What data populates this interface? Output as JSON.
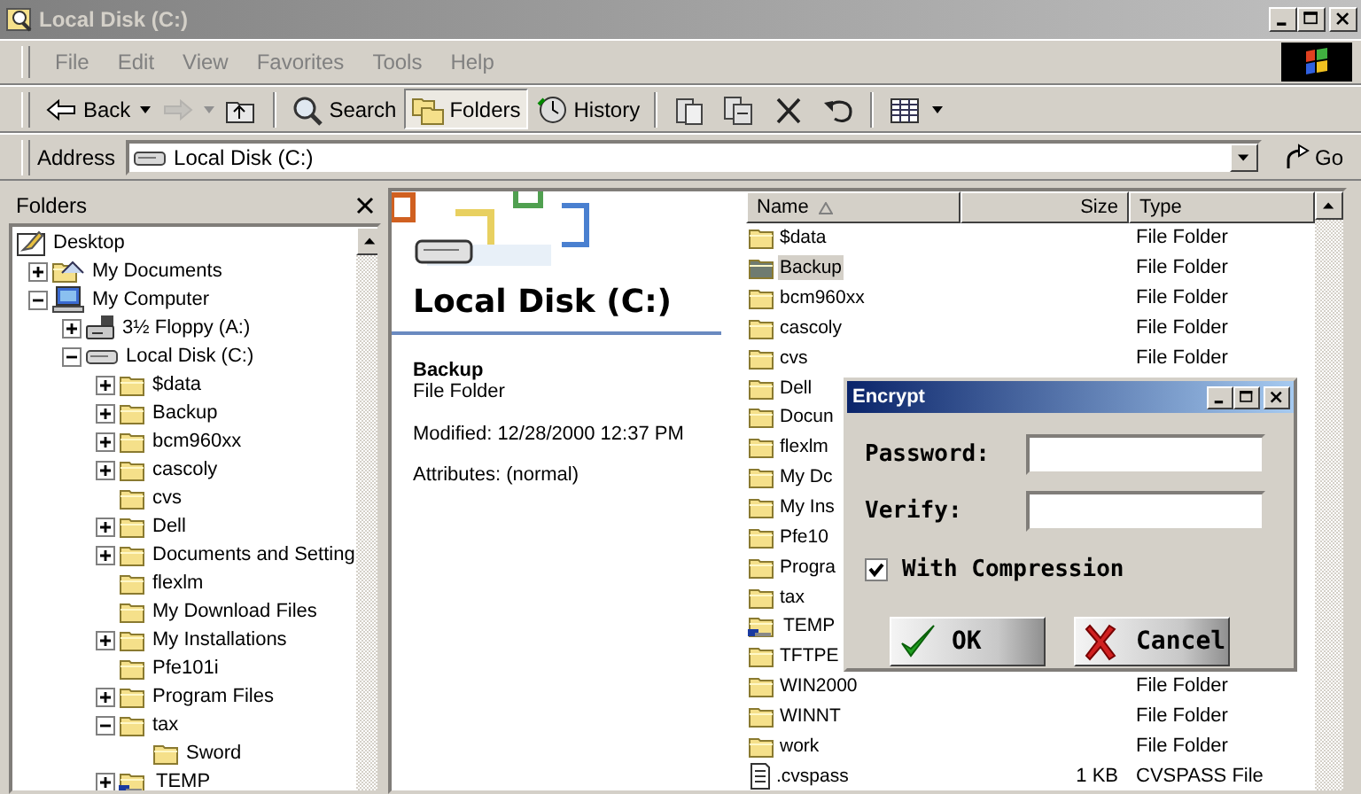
{
  "window": {
    "title": "Local Disk (C:)",
    "active": false
  },
  "menu": [
    "File",
    "Edit",
    "View",
    "Favorites",
    "Tools",
    "Help"
  ],
  "toolbar": {
    "groups": [
      [
        {
          "kind": "back",
          "label": "Back",
          "selected": false,
          "disabled": false
        },
        {
          "kind": "forward",
          "selected": false,
          "disabled": true
        },
        {
          "kind": "up",
          "selected": false,
          "disabled": false
        }
      ],
      [
        {
          "kind": "search",
          "label": "Search",
          "selected": false,
          "disabled": false
        },
        {
          "kind": "folders",
          "label": "Folders",
          "selected": true,
          "disabled": false
        },
        {
          "kind": "history",
          "label": "History",
          "selected": false,
          "disabled": false
        }
      ],
      [
        {
          "kind": "move",
          "selected": false,
          "disabled": false
        },
        {
          "kind": "copy",
          "selected": false,
          "disabled": false
        },
        {
          "kind": "delete",
          "selected": false,
          "disabled": false
        },
        {
          "kind": "undo",
          "selected": false,
          "disabled": false
        }
      ],
      [
        {
          "kind": "views",
          "selected": false,
          "disabled": false
        }
      ]
    ]
  },
  "address": {
    "label": "Address",
    "value": "Local Disk (C:)",
    "go": "Go"
  },
  "folders": {
    "title": "Folders",
    "tree": [
      {
        "kind": "desktop",
        "label": "Desktop",
        "expandable": false,
        "children": [
          {
            "kind": "documents",
            "label": "My Documents",
            "expandable": true,
            "expanded": false
          },
          {
            "kind": "computer",
            "label": "My Computer",
            "expandable": true,
            "expanded": true,
            "children": [
              {
                "kind": "floppy",
                "label": "3½ Floppy (A:)",
                "expandable": true,
                "expanded": false
              },
              {
                "kind": "drive",
                "label": "Local Disk (C:)",
                "expandable": true,
                "expanded": true,
                "children": [
                  {
                    "kind": "folder",
                    "label": "$data",
                    "expandable": true,
                    "expanded": false
                  },
                  {
                    "kind": "folder",
                    "label": "Backup",
                    "expandable": true,
                    "expanded": false
                  },
                  {
                    "kind": "folder",
                    "label": "bcm960xx",
                    "expandable": true,
                    "expanded": false
                  },
                  {
                    "kind": "folder",
                    "label": "cascoly",
                    "expandable": true,
                    "expanded": false
                  },
                  {
                    "kind": "folder",
                    "label": "cvs",
                    "expandable": false
                  },
                  {
                    "kind": "folder",
                    "label": "Dell",
                    "expandable": true,
                    "expanded": false
                  },
                  {
                    "kind": "folder",
                    "label": "Documents and Setting",
                    "expandable": true,
                    "expanded": false
                  },
                  {
                    "kind": "folder",
                    "label": "flexlm",
                    "expandable": false
                  },
                  {
                    "kind": "folder",
                    "label": "My Download Files",
                    "expandable": false
                  },
                  {
                    "kind": "folder",
                    "label": "My Installations",
                    "expandable": true,
                    "expanded": false
                  },
                  {
                    "kind": "folder",
                    "label": "Pfe101i",
                    "expandable": false
                  },
                  {
                    "kind": "folder",
                    "label": "Program Files",
                    "expandable": true,
                    "expanded": false
                  },
                  {
                    "kind": "folder",
                    "label": "tax",
                    "expandable": true,
                    "expanded": true,
                    "children": [
                      {
                        "kind": "folder",
                        "label": "Sword",
                        "expandable": false
                      }
                    ]
                  },
                  {
                    "kind": "shared-folder",
                    "label": "TEMP",
                    "expandable": true,
                    "expanded": false
                  }
                ]
              }
            ]
          }
        ]
      }
    ]
  },
  "info": {
    "heading": "Local Disk (C:)",
    "name": "Backup",
    "type": "File Folder",
    "modified": "Modified: 12/28/2000 12:37 PM",
    "attributes": "Attributes: (normal)"
  },
  "file_list": {
    "columns": [
      {
        "label": "Name",
        "sorted": true
      },
      {
        "label": "Size",
        "sorted": false
      },
      {
        "label": "Type",
        "sorted": false
      }
    ],
    "rows": [
      {
        "kind": "folder",
        "name": "$data",
        "type": "File Folder",
        "selected": false
      },
      {
        "kind": "folder",
        "name": "Backup",
        "type": "File Folder",
        "selected": true
      },
      {
        "kind": "folder",
        "name": "bcm960xx",
        "type": "File Folder",
        "selected": false
      },
      {
        "kind": "folder",
        "name": "cascoly",
        "type": "File Folder",
        "selected": false
      },
      {
        "kind": "folder",
        "name": "cvs",
        "type": "File Folder",
        "selected": false
      },
      {
        "kind": "folder",
        "name": "Dell",
        "selected": false
      },
      {
        "kind": "folder",
        "name": "Docun",
        "selected": false
      },
      {
        "kind": "folder",
        "name": "flexlm",
        "selected": false
      },
      {
        "kind": "folder",
        "name": "My Dc",
        "selected": false
      },
      {
        "kind": "folder",
        "name": "My Ins",
        "selected": false
      },
      {
        "kind": "folder",
        "name": "Pfe10",
        "selected": false
      },
      {
        "kind": "folder",
        "name": "Progra",
        "selected": false
      },
      {
        "kind": "folder",
        "name": "tax",
        "selected": false
      },
      {
        "kind": "shared-folder",
        "name": "TEMP",
        "selected": false
      },
      {
        "kind": "folder",
        "name": "TFTPE",
        "selected": false
      },
      {
        "kind": "folder",
        "name": "WIN2000",
        "type": "File Folder",
        "selected": false
      },
      {
        "kind": "folder",
        "name": "WINNT",
        "type": "File Folder",
        "selected": false
      },
      {
        "kind": "folder",
        "name": "work",
        "type": "File Folder",
        "selected": false
      },
      {
        "kind": "file",
        "name": ".cvspass",
        "size": "1 KB",
        "type": "CVSPASS File",
        "selected": false
      }
    ]
  },
  "dialog": {
    "title": "Encrypt",
    "active": true,
    "fields": [
      {
        "label": "Password:"
      },
      {
        "label": "Verify:"
      }
    ],
    "checkbox": {
      "label": "With Compression",
      "checked": true
    },
    "buttons": [
      {
        "kind": "ok",
        "label": "OK"
      },
      {
        "kind": "cancel",
        "label": "Cancel"
      }
    ]
  }
}
